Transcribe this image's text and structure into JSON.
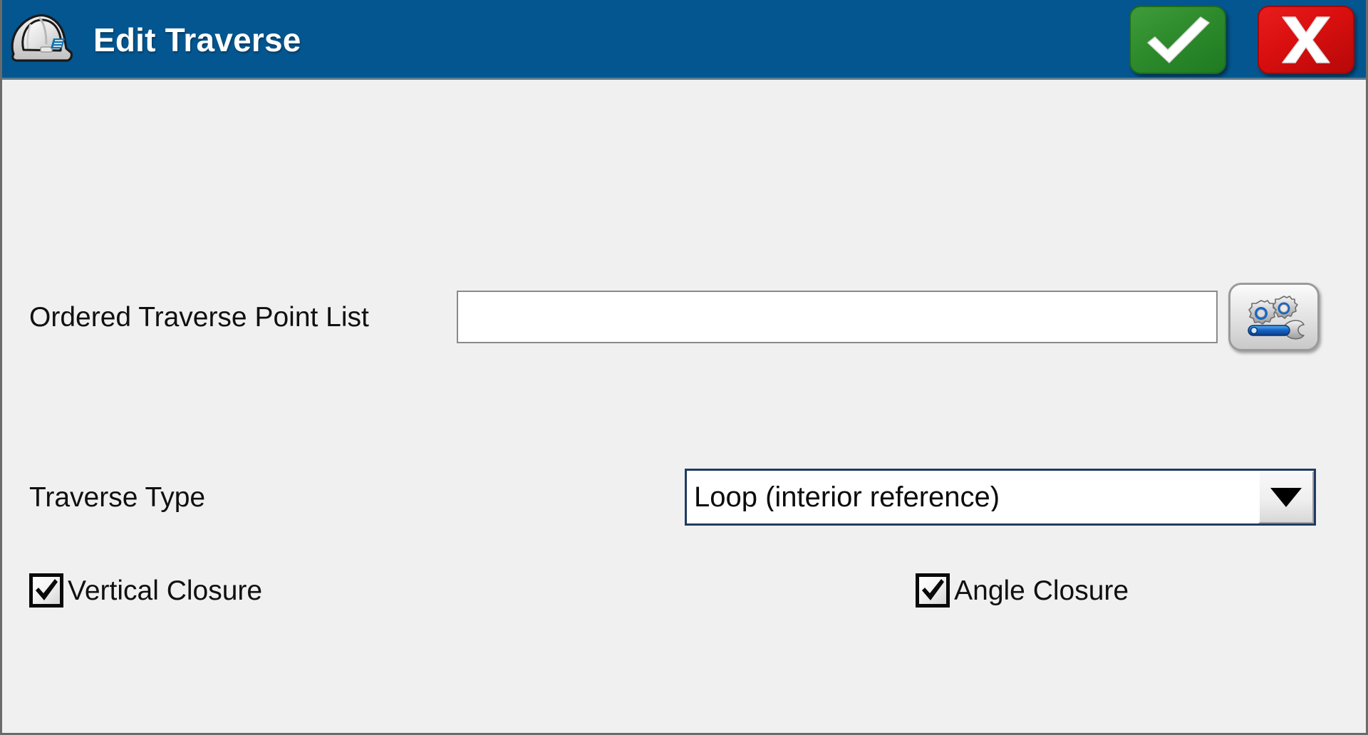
{
  "window": {
    "title": "Edit Traverse",
    "titlebar_color": "#03568f",
    "body_color": "#f0f0f0",
    "app_icon": "hard-hat-icon"
  },
  "titlebar_buttons": {
    "ok": {
      "label": "",
      "icon": "checkmark-icon",
      "color": "#2e8b2c",
      "tooltip": "OK"
    },
    "cancel": {
      "label": "X",
      "icon": "x-icon",
      "color": "#d90f0f",
      "tooltip": "Cancel"
    }
  },
  "form": {
    "point_list": {
      "label": "Ordered Traverse Point List",
      "value": "",
      "placeholder": "",
      "settings_button_icon": "gears-wrench-icon"
    },
    "traverse_type": {
      "label": "Traverse Type",
      "selected": "Loop (interior reference)",
      "dropdown_icon": "chevron-down-icon"
    },
    "vertical_closure": {
      "label": "Vertical Closure",
      "checked": true,
      "check_icon": "checkmark-icon"
    },
    "angle_closure": {
      "label": "Angle Closure",
      "checked": true,
      "check_icon": "checkmark-icon"
    }
  }
}
